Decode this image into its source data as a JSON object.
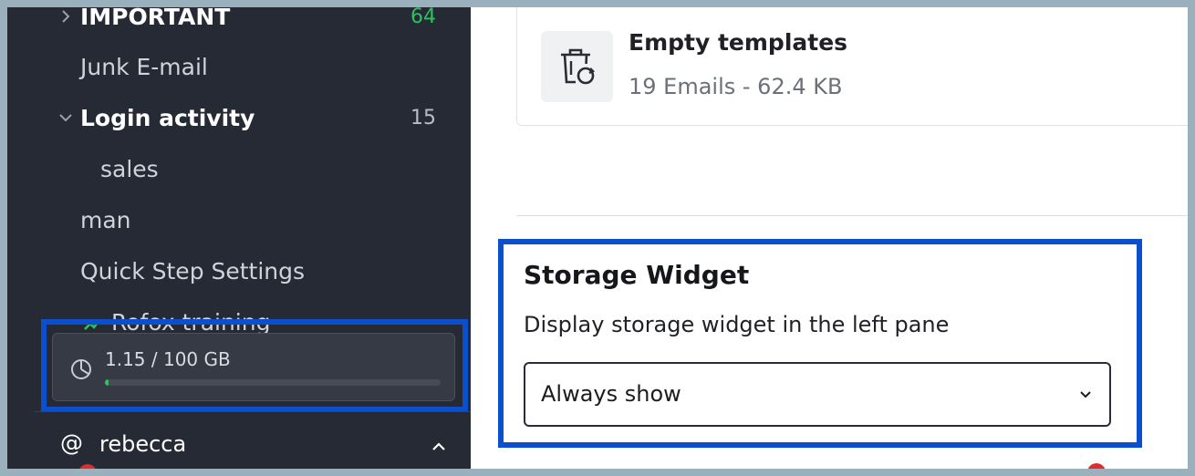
{
  "sidebar": {
    "folders": [
      {
        "label": "IMPORTANT",
        "count": "64",
        "bold": true,
        "chevron": "chevron-right-icon"
      },
      {
        "label": "Junk E-mail",
        "count": "",
        "bold": false
      },
      {
        "label": "Login activity",
        "count": "15",
        "bold": true,
        "chevron": "chevron-down-icon"
      },
      {
        "label": "sales",
        "count": "",
        "bold": false
      },
      {
        "label": "man",
        "count": "",
        "bold": false
      },
      {
        "label": "Quick Step Settings",
        "count": "",
        "bold": false
      },
      {
        "label": "Rofox training",
        "count": "",
        "bold": false,
        "icon": "rule-icon"
      }
    ],
    "storage": {
      "usage_text": "1.15 / 100 GB",
      "used_fraction": 0.0115,
      "icon": "pie-chart-icon"
    },
    "account": {
      "at_symbol": "@",
      "name": "rebecca",
      "toggle_icon": "chevron-up-icon"
    }
  },
  "main": {
    "template_card": {
      "title": "Empty templates",
      "subtitle": "19 Emails - 62.4 KB",
      "icon": "trash-restore-icon"
    },
    "storage_widget": {
      "title": "Storage Widget",
      "description": "Display storage widget in the left pane",
      "selected_option": "Always show"
    }
  },
  "colors": {
    "sidebar_bg": "#252a35",
    "highlight": "#0a4fcb",
    "accent_green": "#2fc161",
    "badge_red": "#e12c2c"
  }
}
